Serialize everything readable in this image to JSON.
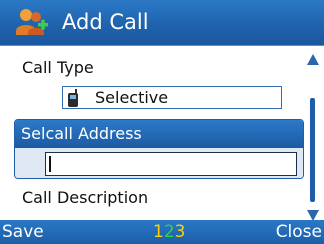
{
  "header": {
    "title": "Add Call",
    "icon": "add-contact-icon"
  },
  "form": {
    "call_type_label": "Call Type",
    "call_type_value": "Selective",
    "call_type_icon": "radio-handset-icon",
    "selcall_address_label": "Selcall Address",
    "selcall_address_value": "",
    "call_description_label": "Call Description"
  },
  "softkeys": {
    "left": "Save",
    "right": "Close"
  },
  "input_mode": {
    "digit1": "1",
    "digit2": "2",
    "digit3": "3"
  },
  "colors": {
    "accent_blue": "#1f63ac",
    "indicator_yellow": "#ffd000",
    "indicator_green": "#2fd24a"
  }
}
